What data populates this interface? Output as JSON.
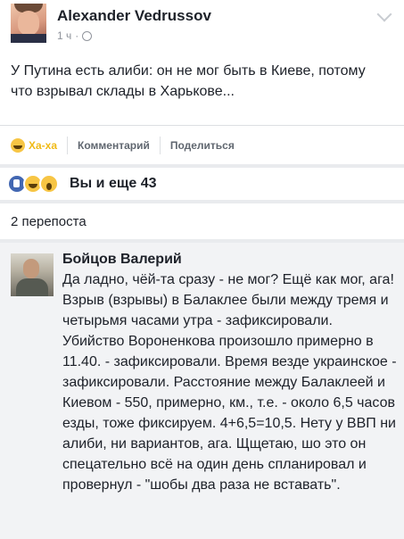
{
  "post": {
    "author": "Alexander Vedrussov",
    "time": "1 ч",
    "text": "У Путина есть алиби: он не мог быть в Киеве, потому что взрывал склады в Харькове..."
  },
  "actions": {
    "reaction_label": "Ха-ха",
    "comment_label": "Комментарий",
    "share_label": "Поделиться"
  },
  "reactions": {
    "summary": "Вы и еще 43",
    "icons": [
      "like-icon",
      "haha-icon",
      "wow-icon"
    ]
  },
  "shares": {
    "label": "2 перепоста"
  },
  "comment": {
    "author": "Бойцов Валерий",
    "text": "Да ладно, чёй-та сразу - не мог? Ещё как мог, ага! Взрыв (взрывы) в Балаклее были между тремя и четырьмя часами утра - зафиксировали. Убийство Вороненкова произошло примерно в 11.40. - зафиксировали. Время везде украинское - зафиксировали. Расстояние между Балаклеей и Киевом - 550, примерно, км., т.е. - около 6,5 часов езды, тоже фиксируем. 4+6,5=10,5. Нету у ВВП ни алиби, ни вариантов, ага. Щщетаю, шо это он спецательно всё на один день спланировал и провернул - \"шобы два раза не вставать\"."
  },
  "colors": {
    "haha": "#f0ba15",
    "like": "#4267b2",
    "muted": "#90949c"
  }
}
